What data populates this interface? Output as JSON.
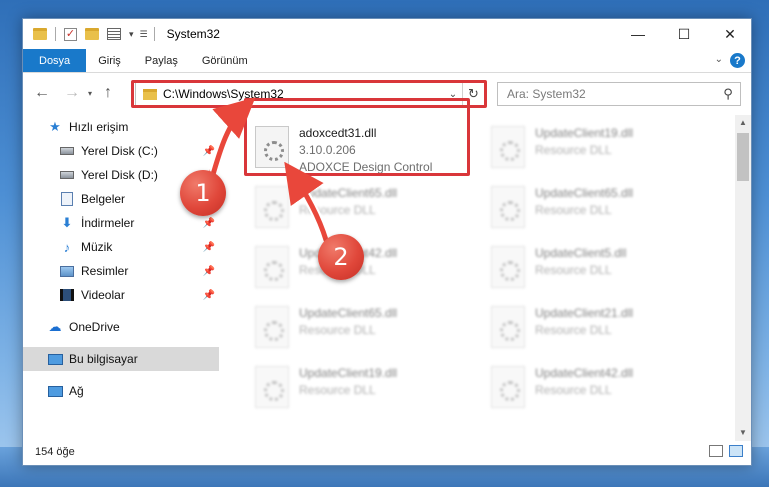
{
  "window": {
    "title": "System32",
    "controls": {
      "minimize": "—",
      "maximize": "☐",
      "close": "✕"
    }
  },
  "ribbon": {
    "tabs": [
      "Dosya",
      "Giriş",
      "Paylaş",
      "Görünüm"
    ],
    "help": "?"
  },
  "nav": {
    "address": "C:\\Windows\\System32",
    "search_placeholder": "Ara: System32"
  },
  "sidebar": {
    "items": [
      {
        "label": "Hızlı erişim",
        "icon": "star-icon"
      },
      {
        "label": "Yerel Disk (C:)",
        "icon": "disk-icon"
      },
      {
        "label": "Yerel Disk (D:)",
        "icon": "disk-icon"
      },
      {
        "label": "Belgeler",
        "icon": "documents-icon"
      },
      {
        "label": "İndirmeler",
        "icon": "download-icon"
      },
      {
        "label": "Müzik",
        "icon": "music-icon"
      },
      {
        "label": "Resimler",
        "icon": "pictures-icon"
      },
      {
        "label": "Videolar",
        "icon": "videos-icon"
      },
      {
        "label": "OneDrive",
        "icon": "cloud-icon"
      },
      {
        "label": "Bu bilgisayar",
        "icon": "computer-icon"
      },
      {
        "label": "Ağ",
        "icon": "network-icon"
      }
    ]
  },
  "files": {
    "featured": {
      "name": "adoxcedt31.dll",
      "version": "3.10.0.206",
      "description": "ADOXCE Design Control"
    },
    "items": [
      {
        "name": "UpdateClient19.dll",
        "description": "Resource DLL"
      },
      {
        "name": "UpdateClient65.dll",
        "description": "Resource DLL"
      },
      {
        "name": "UpdateClient65.dll",
        "description": "Resource DLL"
      },
      {
        "name": "UpdateClient42.dll",
        "description": "Resource DLL"
      },
      {
        "name": "UpdateClient5.dll",
        "description": "Resource DLL"
      },
      {
        "name": "UpdateClient65.dll",
        "description": "Resource DLL"
      },
      {
        "name": "UpdateClient21.dll",
        "description": "Resource DLL"
      },
      {
        "name": "UpdateClient19.dll",
        "description": "Resource DLL"
      },
      {
        "name": "UpdateClient42.dll",
        "description": "Resource DLL"
      }
    ]
  },
  "status": {
    "count": "154 öğe"
  },
  "callouts": {
    "one": "1",
    "two": "2"
  },
  "colors": {
    "accent": "#1979ca",
    "highlight": "#d9363a"
  }
}
